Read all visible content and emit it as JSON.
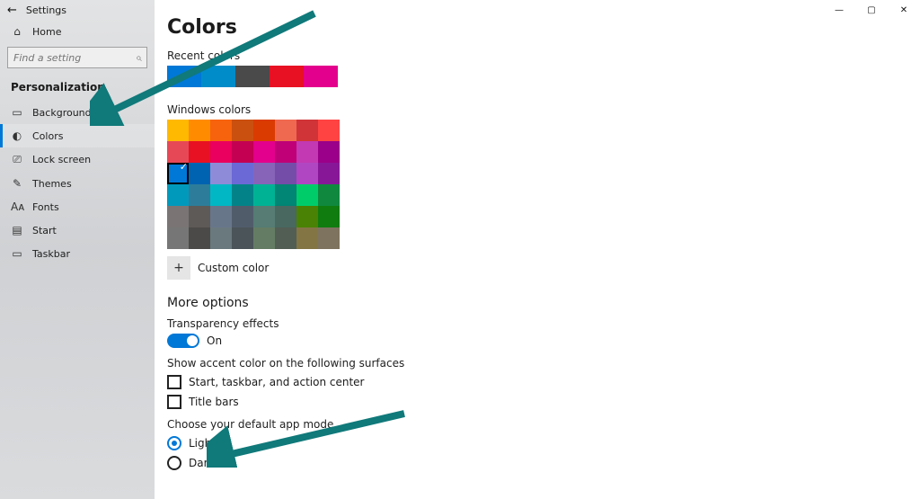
{
  "window": {
    "title": "Settings"
  },
  "sidebar": {
    "home": "Home",
    "search_placeholder": "Find a setting",
    "section": "Personalization",
    "items": [
      {
        "icon": "background-icon",
        "label": "Background"
      },
      {
        "icon": "colors-icon",
        "label": "Colors",
        "selected": true
      },
      {
        "icon": "lockscreen-icon",
        "label": "Lock screen"
      },
      {
        "icon": "themes-icon",
        "label": "Themes"
      },
      {
        "icon": "fonts-icon",
        "label": "Fonts"
      },
      {
        "icon": "start-icon",
        "label": "Start"
      },
      {
        "icon": "taskbar-icon",
        "label": "Taskbar"
      }
    ]
  },
  "page": {
    "title": "Colors",
    "recent_label": "Recent colors",
    "recent_colors": [
      "#0078d7",
      "#008cc9",
      "#4a4a4a",
      "#e81123",
      "#e3008c"
    ],
    "windows_label": "Windows colors",
    "windows_colors": [
      "#ffb900",
      "#ff8c00",
      "#f7630c",
      "#ca5010",
      "#da3b01",
      "#ef6950",
      "#d13438",
      "#ff4343",
      "#e74856",
      "#e81123",
      "#ea005e",
      "#c30052",
      "#e3008c",
      "#bf0077",
      "#c239b3",
      "#9a0089",
      "#0078d7",
      "#0063b1",
      "#8e8cd8",
      "#6b69d6",
      "#8764b8",
      "#744da9",
      "#b146c2",
      "#881798",
      "#0099bc",
      "#2d7d9a",
      "#00b7c3",
      "#038387",
      "#00b294",
      "#018574",
      "#00cc6a",
      "#10893e",
      "#7a7574",
      "#5d5a58",
      "#68768a",
      "#515c6b",
      "#567c73",
      "#486860",
      "#498205",
      "#107c10",
      "#767676",
      "#4c4a48",
      "#69797e",
      "#4a5459",
      "#647c64",
      "#525e54",
      "#847545",
      "#7e735f"
    ],
    "selected_index": 16,
    "custom_label": "Custom color",
    "more_options": "More options",
    "transparency_label": "Transparency effects",
    "transparency_state": "On",
    "surfaces_heading": "Show accent color on the following surfaces",
    "surface1": "Start, taskbar, and action center",
    "surface2": "Title bars",
    "mode_heading": "Choose your default app mode",
    "mode_light": "Light",
    "mode_dark": "Dark",
    "mode_selected": "light"
  },
  "annotations": {
    "arrow_color": "#10797a"
  }
}
